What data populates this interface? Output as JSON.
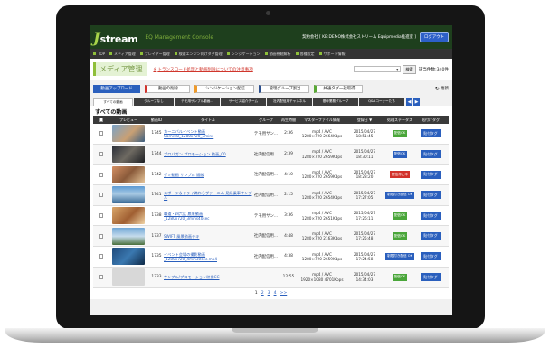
{
  "app": {
    "logo_letter": "J",
    "logo_text": "stream",
    "console_title": "EQ Management Console",
    "company": "契約会社 [ KB:DEMO株式会社ストリーム Equipmedia推進室 ]",
    "logout": "ログアウト"
  },
  "nav": {
    "items": [
      "TOP",
      "メディア管理",
      "プレイヤー管理",
      "検索エンジン向けタグ管理",
      "シンジケーション",
      "動画視聴解析",
      "各種設定",
      "サポート情報"
    ]
  },
  "page": {
    "title": "メディア管理",
    "notice_mark": "※",
    "notice": "トランスコード処理と動画削除についての注意事項",
    "search_button": "検索",
    "total": "該当件数:340件"
  },
  "toolbar": {
    "upload": "動画アップロード",
    "delete": "動画の削除",
    "syndication": "シンジケーション配信",
    "group": "管理グループ割当",
    "tag": "共通タグ一括取得",
    "refresh_icon": "↻",
    "refresh": "更新"
  },
  "tabs": [
    "すべての動画",
    "グループなし",
    "テモ用サンプル動画...",
    "サービス紹介チーム",
    "社内配信用チャンネル",
    "基幹業務グループ",
    "Q&Aコーナーたち"
  ],
  "tab_arrows": [
    "◀",
    "▶"
  ],
  "section_title": "すべての動画",
  "table": {
    "headers": [
      "",
      "プレビュー",
      "動画ID",
      "タイトル",
      "グループ",
      "再生時間",
      "マスターファイル情報",
      "登録日 ▼",
      "処理ステータス",
      "貼付けタグ"
    ],
    "rows": [
      {
        "id": "1745",
        "title": "カーニバルイベント動画\nCarnival_1280x720_3mins",
        "group": "テモ用サン...",
        "time": "2:36",
        "master": "mp4 / AVC\n1280×720 2664Kbps",
        "date": "2015/04/27\n18:51:45",
        "status": "配信OK",
        "status_type": "ok",
        "tag": "貼付タグ",
        "thumb": "#6b8fb0"
      },
      {
        "id": "1744",
        "title": "ブロパガン プロモーション 動画_00",
        "group": "社内配信用...",
        "time": "2:39",
        "master": "mp4 / AVC\n1280×720 2659Kbps",
        "date": "2015/04/27\n18:30:11",
        "status": "配信OK",
        "status_type": "ok",
        "tag": "貼付タグ",
        "thumb": "#3a3f4a"
      },
      {
        "id": "1742",
        "title": "ダミ動画 サンプル 通販",
        "group": "社内配信用...",
        "time": "4:10",
        "master": "mp4 / AVC\n1280×720 2659Kbps",
        "date": "2015/04/27\n18:28:20",
        "status": "配信停止中",
        "status_type": "fail",
        "tag": "貼付タグ",
        "thumb": "#a96b4a"
      },
      {
        "id": "1741",
        "title": "スポーツ＆ドライ満わらヴァーニム 見縁乗車サンプル",
        "group": "社内配信用...",
        "time": "2:15",
        "master": "mp4 / AVC\n1280×720 2654Kbps",
        "date": "2015/04/27\n17:27:05",
        "status": "制限付き配信 OK",
        "status_type": "prog",
        "tag": "貼付タグ",
        "thumb": "#4a7ca8"
      },
      {
        "id": "1738",
        "title": "職道・四六区 鷹来動画\n_1280x720_3mins40sec",
        "group": "テモ用サン...",
        "time": "3:36",
        "master": "mp4 / AVC\n1280×720 2651Kbps",
        "date": "2015/04/27\n17:26:11",
        "status": "配信OK",
        "status_type": "ok",
        "tag": "貼付タグ",
        "thumb": "#c48a52"
      },
      {
        "id": "1737",
        "title": "SWIFT 風景動画テキ",
        "group": "社内配信用...",
        "time": "4:48",
        "master": "mp4 / AVC\n1280×720 2163Kbps",
        "date": "2015/04/27\n17:25:48",
        "status": "配信OK",
        "status_type": "ok",
        "tag": "貼付タグ",
        "thumb": "#5b8fc0"
      },
      {
        "id": "1735",
        "title": "イベント会場の撮影動画\n_1280x720_4min30sec.mp4",
        "group": "社内配信用...",
        "time": "4:38",
        "master": "mp4 / AVC\n1280×720 2659Kbps",
        "date": "2015/04/27\n17:24:58",
        "status": "制限付き配信 OK",
        "status_type": "prog",
        "tag": "貼付タグ",
        "thumb": "#2f5a8a"
      },
      {
        "id": "1733",
        "title": "サンプル/プロモーション映像CC",
        "group": "",
        "time": "12:55",
        "master": "mp4 / AVC\n1920×1080 4701Kbps",
        "date": "2015/04/27\n14:34:03",
        "status": "配信OK",
        "status_type": "ok",
        "tag": "貼付タグ",
        "thumb": "#d8d8d8"
      }
    ]
  },
  "pager": {
    "pages": [
      "1",
      "2",
      "3",
      "4",
      ">>"
    ]
  }
}
